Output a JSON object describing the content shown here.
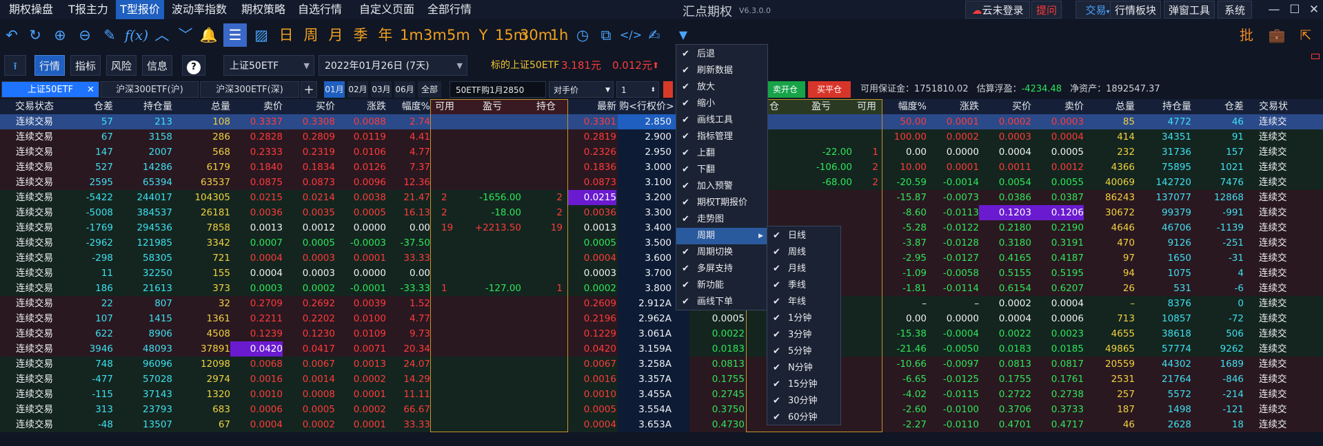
{
  "menubar": {
    "items": [
      "期权操盘",
      "T报主力",
      "T型报价",
      "波动率指数",
      "期权策略",
      "自选行情",
      "自定义页面",
      "全部行情"
    ],
    "active_index": 2,
    "app_title": "汇点期权",
    "version": "V6.3.0.0",
    "right_buttons": [
      "云未登录",
      "提问",
      "交易",
      "行情板块",
      "弹窗工具",
      "系统"
    ]
  },
  "toolbar": {
    "icons": [
      "undo-icon",
      "refresh-icon",
      "zoom-in-icon",
      "zoom-out-icon",
      "draw-pen-icon",
      "formula-icon",
      "arrow-up-icon",
      "arrow-down-icon",
      "alarm-icon",
      "t-quote-icon",
      "chart-icon"
    ],
    "periods": [
      "日",
      "周",
      "月",
      "季",
      "年",
      "1m",
      "3m",
      "5m",
      "Y",
      "15m",
      "30m",
      "1h"
    ],
    "right_icons": [
      "clock-icon",
      "window-icon",
      "code-icon",
      "draw-line-icon",
      "dropdown-arrow-icon"
    ],
    "far_right": [
      "批"
    ]
  },
  "subbar": {
    "tabs": [
      "行情",
      "指标",
      "风险",
      "信息",
      "?"
    ],
    "active_tab": 0,
    "underlying": "上证50ETF",
    "expiry": "2022年01月26日 (7天)",
    "underlying_label": "标的上证50ETF",
    "price": "3.181元",
    "change": "0.012元",
    "change_arrow": "⬆"
  },
  "quotebar": {
    "tabs": [
      "上证50ETF",
      "沪深300ETF(沪)",
      "沪深300ETF(深)"
    ],
    "active_tab": 0,
    "add": "+",
    "months": [
      "01月",
      "02月",
      "03月",
      "06月",
      "全部"
    ],
    "active_month": 0,
    "contract": "50ETF购1月2850",
    "price_type": "对手价",
    "qty": "1",
    "buy_open": "卖开仓",
    "buy_close": "买平仓",
    "margin_label": "可用保证金：",
    "margin": "1751810.02",
    "float_label": "估算浮盈：",
    "float": "-4234.48",
    "net_label": "净资产：",
    "net": "1892547.37"
  },
  "table": {
    "call_headers": [
      "交易状态",
      "仓差",
      "持仓量",
      "总量",
      "卖价",
      "买价",
      "涨跌",
      "幅度%",
      "可用",
      "盈亏",
      "持仓"
    ],
    "mid_headers": [
      "最新",
      "购<行权价>"
    ],
    "put_headers": [
      "仓",
      "盈亏",
      "可用",
      "幅度%",
      "涨跌",
      "买价",
      "卖价",
      "总量",
      "持仓量",
      "仓差",
      "交易状"
    ],
    "rows": [
      {
        "s": "连续交易",
        "cd": "57",
        "oi": "213",
        "vol": "108",
        "ask": "0.3337",
        "bid": "0.3308",
        "chg": "0.0088",
        "pct": "2.74",
        "av": "",
        "pl": "",
        "pos": "",
        "last": "0.3301",
        "strike": "2.850",
        "ppos": "",
        "ppl": "",
        "pav": "",
        "ppct": "50.00",
        "pchg": "0.0001",
        "pbid": "0.0002",
        "pask": "0.0003",
        "pvol": "85",
        "poi": "4772",
        "pcd": "46",
        "ps": "连续交"
      },
      {
        "s": "连续交易",
        "cd": "67",
        "oi": "3158",
        "vol": "286",
        "ask": "0.2828",
        "bid": "0.2809",
        "chg": "0.0119",
        "pct": "4.41",
        "av": "",
        "pl": "",
        "pos": "",
        "last": "0.2819",
        "strike": "2.900",
        "ppos": "",
        "ppl": "",
        "pav": "",
        "ppct": "100.00",
        "pchg": "0.0002",
        "pbid": "0.0003",
        "pask": "0.0004",
        "pvol": "414",
        "poi": "34351",
        "pcd": "91",
        "ps": "连续交"
      },
      {
        "s": "连续交易",
        "cd": "147",
        "oi": "2007",
        "vol": "568",
        "ask": "0.2333",
        "bid": "0.2319",
        "chg": "0.0106",
        "pct": "4.77",
        "av": "",
        "pl": "",
        "pos": "",
        "last": "0.2326",
        "strike": "2.950",
        "ppos": "",
        "ppl": "-22.00",
        "pav": "1",
        "ppct": "0.00",
        "pchg": "0.0000",
        "pbid": "0.0004",
        "pask": "0.0005",
        "pvol": "232",
        "poi": "31736",
        "pcd": "157",
        "ps": "连续交"
      },
      {
        "s": "连续交易",
        "cd": "527",
        "oi": "14286",
        "vol": "6179",
        "ask": "0.1840",
        "bid": "0.1834",
        "chg": "0.0126",
        "pct": "7.37",
        "av": "",
        "pl": "",
        "pos": "",
        "last": "0.1836",
        "strike": "3.000",
        "ppos": "",
        "ppl": "-106.00",
        "pav": "2",
        "ppct": "10.00",
        "pchg": "0.0001",
        "pbid": "0.0011",
        "pask": "0.0012",
        "pvol": "4366",
        "poi": "75895",
        "pcd": "1021",
        "ps": "连续交"
      },
      {
        "s": "连续交易",
        "cd": "2595",
        "oi": "65394",
        "vol": "63537",
        "ask": "0.0875",
        "bid": "0.0873",
        "chg": "0.0096",
        "pct": "12.36",
        "av": "",
        "pl": "",
        "pos": "",
        "last": "0.0873",
        "strike": "3.100",
        "ppos": "",
        "ppl": "-68.00",
        "pav": "2",
        "ppct": "-20.59",
        "pchg": "-0.0014",
        "pbid": "0.0054",
        "pask": "0.0055",
        "pvol": "40069",
        "poi": "142720",
        "pcd": "7476",
        "ps": "连续交"
      },
      {
        "s": "连续交易",
        "cd": "-5422",
        "oi": "244017",
        "vol": "104305",
        "ask": "0.0215",
        "bid": "0.0214",
        "chg": "0.0038",
        "pct": "21.47",
        "av": "2",
        "pl": "-1656.00",
        "pos": "2",
        "last": "0.0215",
        "strike": "3.200",
        "ppos": "",
        "ppl": "",
        "pav": "",
        "ppct": "-15.87",
        "pchg": "-0.0073",
        "pbid": "0.0386",
        "pask": "0.0387",
        "pvol": "86243",
        "poi": "137077",
        "pcd": "12868",
        "ps": "连续交"
      },
      {
        "s": "连续交易",
        "cd": "-5008",
        "oi": "384537",
        "vol": "26181",
        "ask": "0.0036",
        "bid": "0.0035",
        "chg": "0.0005",
        "pct": "16.13",
        "av": "2",
        "pl": "-18.00",
        "pos": "2",
        "last": "0.0036",
        "strike": "3.300",
        "ppos": "",
        "ppl": "",
        "pav": "",
        "ppct": "-8.60",
        "pchg": "-0.0113",
        "pbid": "0.1203",
        "pask": "0.1206",
        "pvol": "30672",
        "poi": "99379",
        "pcd": "-991",
        "ps": "连续交"
      },
      {
        "s": "连续交易",
        "cd": "-1769",
        "oi": "294536",
        "vol": "7858",
        "ask": "0.0013",
        "bid": "0.0012",
        "chg": "0.0000",
        "pct": "0.00",
        "av": "19",
        "pl": "+2213.50",
        "pos": "19",
        "last": "0.0013",
        "strike": "3.400",
        "ppos": "",
        "ppl": "",
        "pav": "",
        "ppct": "-5.28",
        "pchg": "-0.0122",
        "pbid": "0.2180",
        "pask": "0.2190",
        "pvol": "4646",
        "poi": "46706",
        "pcd": "-1139",
        "ps": "连续交"
      },
      {
        "s": "连续交易",
        "cd": "-2962",
        "oi": "121985",
        "vol": "3342",
        "ask": "0.0007",
        "bid": "0.0005",
        "chg": "-0.0003",
        "pct": "-37.50",
        "av": "",
        "pl": "",
        "pos": "",
        "last": "0.0005",
        "strike": "3.500",
        "ppos": "",
        "ppl": "",
        "pav": "",
        "ppct": "-3.87",
        "pchg": "-0.0128",
        "pbid": "0.3180",
        "pask": "0.3191",
        "pvol": "470",
        "poi": "9126",
        "pcd": "-251",
        "ps": "连续交"
      },
      {
        "s": "连续交易",
        "cd": "-298",
        "oi": "58305",
        "vol": "721",
        "ask": "0.0004",
        "bid": "0.0003",
        "chg": "0.0001",
        "pct": "33.33",
        "av": "",
        "pl": "",
        "pos": "",
        "last": "0.0004",
        "strike": "3.600",
        "ppos": "",
        "ppl": "",
        "pav": "",
        "ppct": "-2.95",
        "pchg": "-0.0127",
        "pbid": "0.4165",
        "pask": "0.4187",
        "pvol": "97",
        "poi": "1650",
        "pcd": "-31",
        "ps": "连续交"
      },
      {
        "s": "连续交易",
        "cd": "11",
        "oi": "32250",
        "vol": "155",
        "ask": "0.0004",
        "bid": "0.0003",
        "chg": "0.0000",
        "pct": "0.00",
        "av": "",
        "pl": "",
        "pos": "",
        "last": "0.0003",
        "strike": "3.700",
        "ppos": "",
        "ppl": "",
        "pav": "",
        "ppct": "-1.09",
        "pchg": "-0.0058",
        "pbid": "0.5155",
        "pask": "0.5195",
        "pvol": "94",
        "poi": "1075",
        "pcd": "4",
        "ps": "连续交"
      },
      {
        "s": "连续交易",
        "cd": "186",
        "oi": "21613",
        "vol": "373",
        "ask": "0.0003",
        "bid": "0.0002",
        "chg": "-0.0001",
        "pct": "-33.33",
        "av": "1",
        "pl": "-127.00",
        "pos": "1",
        "last": "0.0002",
        "strike": "3.800",
        "ppos": "",
        "ppl": "",
        "pav": "",
        "ppct": "-1.81",
        "pchg": "-0.0114",
        "pbid": "0.6154",
        "pask": "0.6207",
        "pvol": "26",
        "poi": "531",
        "pcd": "-6",
        "ps": "连续交"
      },
      {
        "s": "连续交易",
        "cd": "22",
        "oi": "807",
        "vol": "32",
        "ask": "0.2709",
        "bid": "0.2692",
        "chg": "0.0039",
        "pct": "1.52",
        "av": "",
        "pl": "",
        "pos": "",
        "last": "0.2609",
        "strike": "2.912A",
        "plast": "",
        "ppos": "",
        "ppl": "",
        "pav": "",
        "ppct": "–",
        "pchg": "–",
        "pbid": "0.0002",
        "pask": "0.0004",
        "pvol": "–",
        "poi": "8376",
        "pcd": "0",
        "ps": "连续交"
      },
      {
        "s": "连续交易",
        "cd": "107",
        "oi": "1415",
        "vol": "1361",
        "ask": "0.2211",
        "bid": "0.2202",
        "chg": "0.0100",
        "pct": "4.77",
        "av": "",
        "pl": "",
        "pos": "",
        "last": "0.2196",
        "strike": "2.962A",
        "plast": "0.0005",
        "ppos": "",
        "ppl": "",
        "pav": "",
        "ppct": "0.00",
        "pchg": "0.0000",
        "pbid": "0.0004",
        "pask": "0.0006",
        "pvol": "713",
        "poi": "10857",
        "pcd": "-72",
        "ps": "连续交"
      },
      {
        "s": "连续交易",
        "cd": "622",
        "oi": "8906",
        "vol": "4508",
        "ask": "0.1239",
        "bid": "0.1230",
        "chg": "0.0109",
        "pct": "9.73",
        "av": "",
        "pl": "",
        "pos": "",
        "last": "0.1229",
        "strike": "3.061A",
        "plast": "0.0022",
        "ppos": "",
        "ppl": "",
        "pav": "",
        "ppct": "-15.38",
        "pchg": "-0.0004",
        "pbid": "0.0022",
        "pask": "0.0023",
        "pvol": "4655",
        "poi": "38618",
        "pcd": "506",
        "ps": "连续交"
      },
      {
        "s": "连续交易",
        "cd": "3946",
        "oi": "48093",
        "vol": "37891",
        "ask": "0.0420",
        "bid": "0.0417",
        "chg": "0.0071",
        "pct": "20.34",
        "av": "",
        "pl": "",
        "pos": "",
        "last": "0.0420",
        "strike": "3.159A",
        "plast": "0.0183",
        "ppos": "",
        "ppl": "",
        "pav": "",
        "ppct": "-21.46",
        "pchg": "-0.0050",
        "pbid": "0.0183",
        "pask": "0.0185",
        "pvol": "49865",
        "poi": "57774",
        "pcd": "9262",
        "ps": "连续交"
      },
      {
        "s": "连续交易",
        "cd": "748",
        "oi": "96096",
        "vol": "12098",
        "ask": "0.0068",
        "bid": "0.0067",
        "chg": "0.0013",
        "pct": "24.07",
        "av": "",
        "pl": "",
        "pos": "",
        "last": "0.0067",
        "strike": "3.258A",
        "plast": "0.0813",
        "ppos": "",
        "ppl": "",
        "pav": "",
        "ppct": "-10.66",
        "pchg": "-0.0097",
        "pbid": "0.0813",
        "pask": "0.0817",
        "pvol": "20559",
        "poi": "44302",
        "pcd": "1689",
        "ps": "连续交"
      },
      {
        "s": "连续交易",
        "cd": "-477",
        "oi": "57028",
        "vol": "2974",
        "ask": "0.0016",
        "bid": "0.0014",
        "chg": "0.0002",
        "pct": "14.29",
        "av": "",
        "pl": "",
        "pos": "",
        "last": "0.0016",
        "strike": "3.357A",
        "plast": "0.1755",
        "ppos": "",
        "ppl": "",
        "pav": "",
        "ppct": "-6.65",
        "pchg": "-0.0125",
        "pbid": "0.1755",
        "pask": "0.1761",
        "pvol": "2531",
        "poi": "21764",
        "pcd": "-846",
        "ps": "连续交"
      },
      {
        "s": "连续交易",
        "cd": "-115",
        "oi": "37143",
        "vol": "1320",
        "ask": "0.0010",
        "bid": "0.0008",
        "chg": "0.0001",
        "pct": "11.11",
        "av": "",
        "pl": "",
        "pos": "",
        "last": "0.0010",
        "strike": "3.455A",
        "plast": "0.2745",
        "ppos": "",
        "ppl": "",
        "pav": "",
        "ppct": "-4.02",
        "pchg": "-0.0115",
        "pbid": "0.2722",
        "pask": "0.2738",
        "pvol": "257",
        "poi": "5572",
        "pcd": "-214",
        "ps": "连续交"
      },
      {
        "s": "连续交易",
        "cd": "313",
        "oi": "23793",
        "vol": "683",
        "ask": "0.0006",
        "bid": "0.0005",
        "chg": "0.0002",
        "pct": "66.67",
        "av": "",
        "pl": "",
        "pos": "",
        "last": "0.0005",
        "strike": "3.554A",
        "plast": "0.3750",
        "ppos": "",
        "ppl": "",
        "pav": "",
        "ppct": "-2.60",
        "pchg": "-0.0100",
        "pbid": "0.3706",
        "pask": "0.3733",
        "pvol": "187",
        "poi": "1498",
        "pcd": "-121",
        "ps": "连续交"
      },
      {
        "s": "连续交易",
        "cd": "-48",
        "oi": "13507",
        "vol": "67",
        "ask": "0.0004",
        "bid": "0.0002",
        "chg": "0.0001",
        "pct": "33.33",
        "av": "",
        "pl": "",
        "pos": "",
        "last": "0.0004",
        "strike": "3.653A",
        "plast": "0.4730",
        "ppos": "",
        "ppl": "",
        "pav": "",
        "ppct": "-2.27",
        "pchg": "-0.0110",
        "pbid": "0.4701",
        "pask": "0.4717",
        "pvol": "46",
        "poi": "2628",
        "pcd": "18",
        "ps": "连续交"
      }
    ]
  },
  "context_menu": {
    "items": [
      "后退",
      "刷新数据",
      "放大",
      "缩小",
      "画线工具",
      "指标管理",
      "上翻",
      "下翻",
      "加入预警",
      "期权T期报价",
      "走势图",
      "周期",
      "周期切换",
      "多屏支持",
      "新功能",
      "画线下单"
    ],
    "checked": [
      true,
      true,
      true,
      true,
      true,
      true,
      true,
      true,
      true,
      true,
      true,
      false,
      true,
      true,
      true,
      true
    ],
    "submenu_index": 11,
    "submenu_arrow": "▶"
  },
  "period_submenu": {
    "items": [
      "日线",
      "周线",
      "月线",
      "季线",
      "年线",
      "1分钟",
      "3分钟",
      "5分钟",
      "N分钟",
      "15分钟",
      "30分钟",
      "60分钟"
    ]
  },
  "colors": {
    "accent": "#1e5fbf",
    "up": "#ff3b3b",
    "down": "#2ee65a",
    "neutral": "#3ee0f0"
  }
}
